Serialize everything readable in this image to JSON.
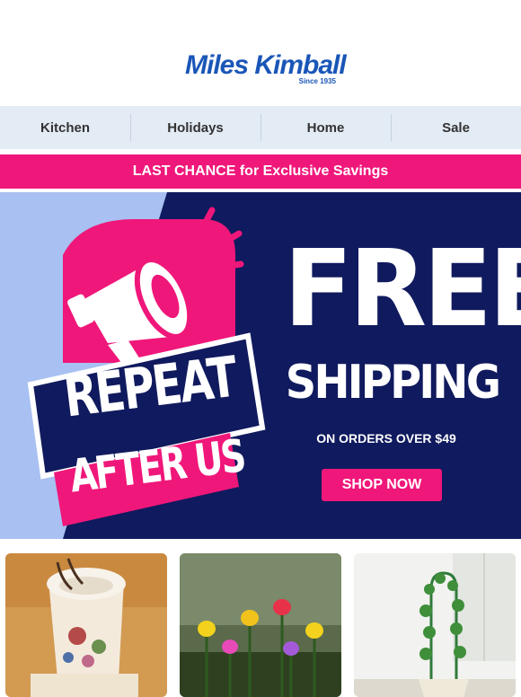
{
  "brand": {
    "name": "Miles Kimball",
    "tagline": "Since 1935"
  },
  "nav": {
    "items": [
      {
        "label": "Kitchen"
      },
      {
        "label": "Holidays"
      },
      {
        "label": "Home"
      },
      {
        "label": "Sale"
      }
    ]
  },
  "promo_bar": {
    "text": "LAST CHANCE for Exclusive Savings"
  },
  "hero": {
    "badge_line1": "REPEAT",
    "badge_line2": "AFTER US",
    "headline_1": "FREE",
    "headline_2": "SHIPPING",
    "subtext": "ON ORDERS OVER $49",
    "cta": "SHOP NOW"
  },
  "colors": {
    "brand_blue": "#1a56b8",
    "pink": "#f0177a",
    "navy": "#101a5e",
    "light_blue": "#a9c0f2",
    "nav_bg": "#e3ebf5"
  },
  "products": [
    {
      "icon": "tapestry-glasses-holder-image"
    },
    {
      "icon": "tulip-solar-lights-image"
    },
    {
      "icon": "ivy-topiary-plant-image"
    }
  ]
}
